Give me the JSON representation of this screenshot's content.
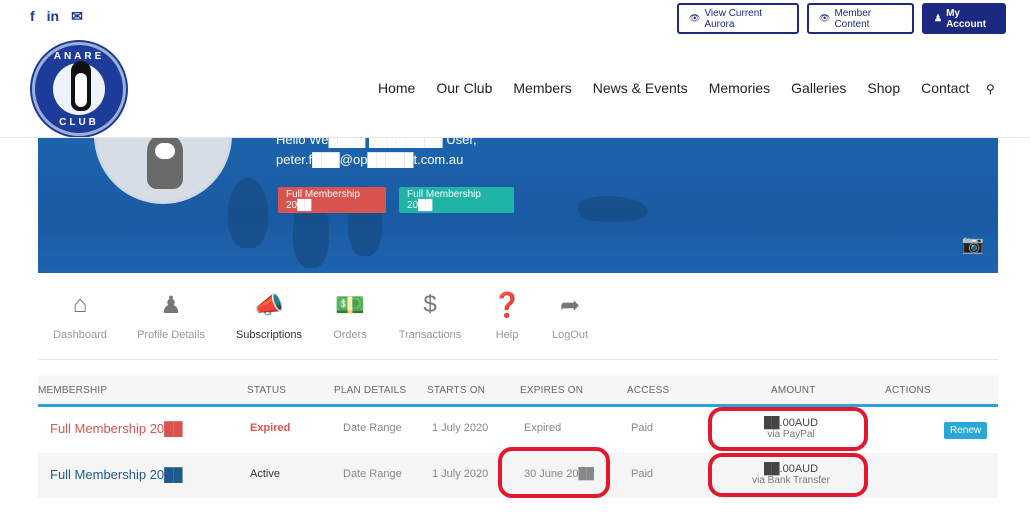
{
  "social": {
    "facebook": "f",
    "linkedin": "in",
    "email": "✉"
  },
  "top_buttons": {
    "aurora": "View Current Aurora",
    "member_content": "Member Content",
    "account": "My Account"
  },
  "logo": {
    "top_text": "ANARE",
    "bottom_text": "CLUB"
  },
  "nav": {
    "items": [
      "Home",
      "Our Club",
      "Members",
      "News & Events",
      "Memories",
      "Galleries",
      "Shop",
      "Contact"
    ],
    "search_icon": "search-icon"
  },
  "banner": {
    "greeting": "Hello We████ ████████ User,",
    "email": "peter.f███@op█████t.com.au",
    "tags": [
      "Full Membership 20██",
      "Full Membership 20██"
    ]
  },
  "tabs": [
    {
      "label": "Dashboard",
      "icon": "home-icon"
    },
    {
      "label": "Profile Details",
      "icon": "user-icon"
    },
    {
      "label": "Subscriptions",
      "icon": "megaphone-icon"
    },
    {
      "label": "Orders",
      "icon": "money-icon"
    },
    {
      "label": "Transactions",
      "icon": "dollar-icon"
    },
    {
      "label": "Help",
      "icon": "question-icon"
    },
    {
      "label": "LogOut",
      "icon": "logout-icon"
    }
  ],
  "table": {
    "headers": [
      "MEMBERSHIP",
      "STATUS",
      "PLAN DETAILS",
      "STARTS ON",
      "EXPIRES ON",
      "ACCESS",
      "AMOUNT",
      "ACTIONS"
    ],
    "rows": [
      {
        "membership": "Full Membership 20██",
        "status": "Expired",
        "plan": "Date Range",
        "starts": "1 July 2020",
        "expires": "Expired",
        "access": "Paid",
        "amount": "██.00AUD",
        "via": "via PayPal",
        "action": "Renew"
      },
      {
        "membership": "Full Membership 20██",
        "status": "Active",
        "plan": "Date Range",
        "starts": "1 July 2020",
        "expires": "30 June 20██",
        "access": "Paid",
        "amount": "██.00AUD",
        "via": "via Bank Transfer",
        "action": ""
      }
    ]
  },
  "colors": {
    "brand": "#1b2a80",
    "accent": "#2ea3d6",
    "expired": "#d9534f",
    "highlight": "#e3172d"
  }
}
